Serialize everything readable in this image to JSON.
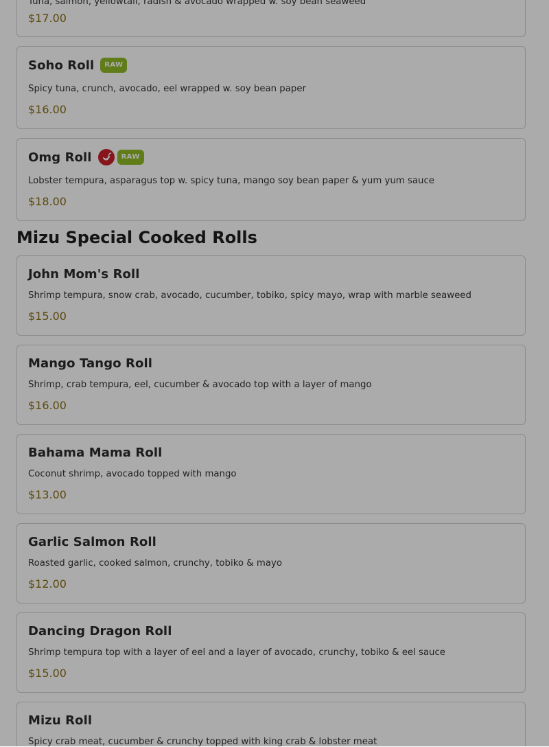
{
  "top_partial": {
    "desc": "Tuna, salmon, yellowtail, radish & avocado wrapped w. soy bean seaweed",
    "price": "$17.00"
  },
  "raw_items": [
    {
      "name": "Soho Roll",
      "tags": [
        "raw"
      ],
      "raw_label": "RAW",
      "desc": "Spicy tuna, crunch, avocado, eel wrapped w. soy bean paper",
      "price": "$16.00"
    },
    {
      "name": "Omg Roll",
      "tags": [
        "spicy",
        "raw"
      ],
      "raw_label": "RAW",
      "desc": "Lobster tempura, asparagus top w. spicy tuna, mango soy bean paper & yum yum sauce",
      "price": "$18.00"
    }
  ],
  "cooked_section": {
    "title": "Mizu Special Cooked Rolls",
    "items": [
      {
        "name": "John Mom's Roll",
        "desc": "Shrimp tempura, snow crab, avocado, cucumber, tobiko, spicy mayo, wrap with marble seaweed",
        "price": "$15.00"
      },
      {
        "name": "Mango Tango Roll",
        "desc": "Shrimp, crab tempura, eel, cucumber & avocado top with a layer of mango",
        "price": "$16.00"
      },
      {
        "name": "Bahama Mama Roll",
        "desc": "Coconut shrimp, avocado topped with mango",
        "price": "$13.00"
      },
      {
        "name": "Garlic Salmon Roll",
        "desc": "Roasted garlic, cooked salmon, crunchy, tobiko & mayo",
        "price": "$12.00"
      },
      {
        "name": "Dancing Dragon Roll",
        "desc": "Shrimp tempura top with a layer of eel and a layer of avocado, crunchy, tobiko & eel sauce",
        "price": "$15.00"
      },
      {
        "name": "Mizu Roll",
        "desc": "Spicy crab meat, cucumber & crunchy topped with king crab & lobster meat",
        "price": ""
      }
    ]
  },
  "colors": {
    "price": "#8a6e16",
    "raw_badge": "#8fbb26",
    "spicy_badge": "#c8202a",
    "card_border": "#cfcfcf",
    "overlay": "rgba(0,0,0,0.33)"
  },
  "icons": {
    "spicy": "chili-pepper-icon"
  }
}
